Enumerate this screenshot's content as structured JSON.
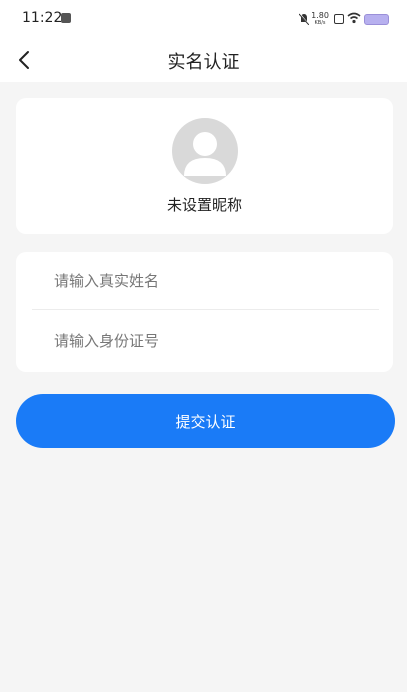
{
  "status_bar": {
    "time": "11:22",
    "speed": "1.80",
    "speed_unit": "KB/s",
    "battery_color": "#b7b0ef"
  },
  "header": {
    "title": "实名认证",
    "back_icon": "chevron-left-icon"
  },
  "profile": {
    "avatar_icon": "default-avatar-icon",
    "nickname": "未设置昵称"
  },
  "form": {
    "name_placeholder": "请输入真实姓名",
    "name_value": "",
    "id_placeholder": "请输入身份证号",
    "id_value": ""
  },
  "actions": {
    "submit_label": "提交认证",
    "accent_color": "#1a7bf7"
  }
}
